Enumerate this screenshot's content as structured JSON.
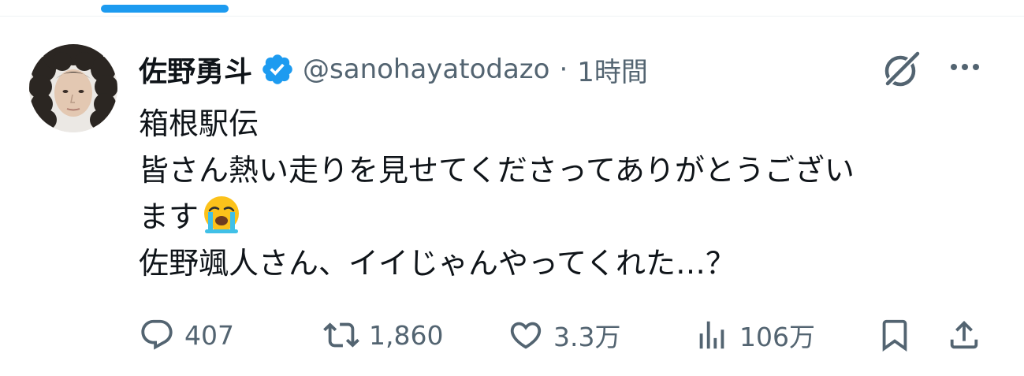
{
  "author": {
    "display_name": "佐野勇斗",
    "handle": "@sanohayatodazo",
    "separator": "·",
    "timestamp": "1時間",
    "verified": true
  },
  "post": {
    "lines": [
      "箱根駅伝",
      "皆さん熱い走りを見せてくださってありがとうござい",
      "ます",
      "佐野颯人さん、イイじゃんやってくれた…？"
    ],
    "emoji": "loudly-crying-face"
  },
  "actions": {
    "replies": "407",
    "reposts": "1,860",
    "likes": "3.3万",
    "views": "106万"
  },
  "icons": {
    "verified": "verified-badge-icon",
    "grok": "grok-icon",
    "more": "more-icon",
    "reply": "reply-icon",
    "repost": "repost-icon",
    "like": "like-icon",
    "views": "views-icon",
    "bookmark": "bookmark-icon",
    "share": "share-icon"
  },
  "colors": {
    "accent": "#1d9bf0",
    "text": "#0f1419",
    "secondary": "#536471"
  }
}
